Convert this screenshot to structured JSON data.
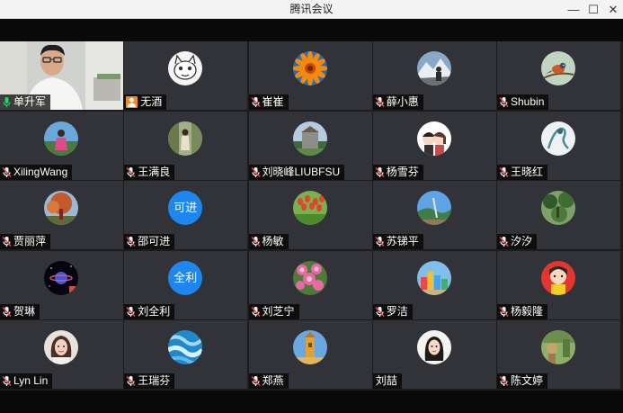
{
  "window": {
    "title": "腾讯会议",
    "min_label": "—",
    "max_label": "☐",
    "close_label": "✕"
  },
  "participants": [
    {
      "name": "单升军",
      "avatar": "camera-video",
      "mic": "active"
    },
    {
      "name": "无酒",
      "avatar": "cartoon-cat",
      "mic": "none",
      "badge": "host-person-icon"
    },
    {
      "name": "崔崔",
      "avatar": "orange-flower",
      "mic": "muted"
    },
    {
      "name": "薛小惠",
      "avatar": "snow-mountain-person",
      "mic": "muted"
    },
    {
      "name": "Shubin",
      "avatar": "bird-branch",
      "mic": "muted"
    },
    {
      "name": "XilingWang",
      "avatar": "person-outdoor-pink",
      "mic": "muted"
    },
    {
      "name": "王满良",
      "avatar": "person-garden",
      "mic": "muted"
    },
    {
      "name": "刘晓峰LIUBFSU",
      "avatar": "building-trees",
      "mic": "muted"
    },
    {
      "name": "杨雪芬",
      "avatar": "cartoon-couple",
      "mic": "muted"
    },
    {
      "name": "王晓红",
      "avatar": "sketch-figure",
      "mic": "muted"
    },
    {
      "name": "贾丽萍",
      "avatar": "autumn-tree-person",
      "mic": "muted"
    },
    {
      "name": "邵可进",
      "avatar": "text",
      "avatar_text": "可进",
      "mic": "muted"
    },
    {
      "name": "杨敏",
      "avatar": "tulips",
      "mic": "muted"
    },
    {
      "name": "苏锑平",
      "avatar": "sky-landscape",
      "mic": "muted"
    },
    {
      "name": "汐汐",
      "avatar": "forest-green",
      "mic": "muted"
    },
    {
      "name": "贺琳",
      "avatar": "space-planet",
      "mic": "muted"
    },
    {
      "name": "刘全利",
      "avatar": "text",
      "avatar_text": "全利",
      "mic": "muted"
    },
    {
      "name": "刘芝宁",
      "avatar": "pink-flowers",
      "mic": "muted"
    },
    {
      "name": "罗洁",
      "avatar": "colorful-buildings",
      "mic": "muted"
    },
    {
      "name": "杨毅隆",
      "avatar": "cartoon-girl-red",
      "mic": "muted"
    },
    {
      "name": "Lyn Lin",
      "avatar": "woman-portrait",
      "mic": "muted"
    },
    {
      "name": "王瑞芬",
      "avatar": "blue-water",
      "mic": "muted"
    },
    {
      "name": "郑燕",
      "avatar": "golden-tower",
      "mic": "muted"
    },
    {
      "name": "刘喆",
      "avatar": "girl-portrait",
      "mic": "none"
    },
    {
      "name": "陈文婷",
      "avatar": "green-painting",
      "mic": "muted"
    }
  ],
  "colors": {
    "tile_bg": "#323338",
    "active_speaker": "#2bd16a",
    "text_avatar": "#1e86ef",
    "mute_red": "#e0463e"
  }
}
